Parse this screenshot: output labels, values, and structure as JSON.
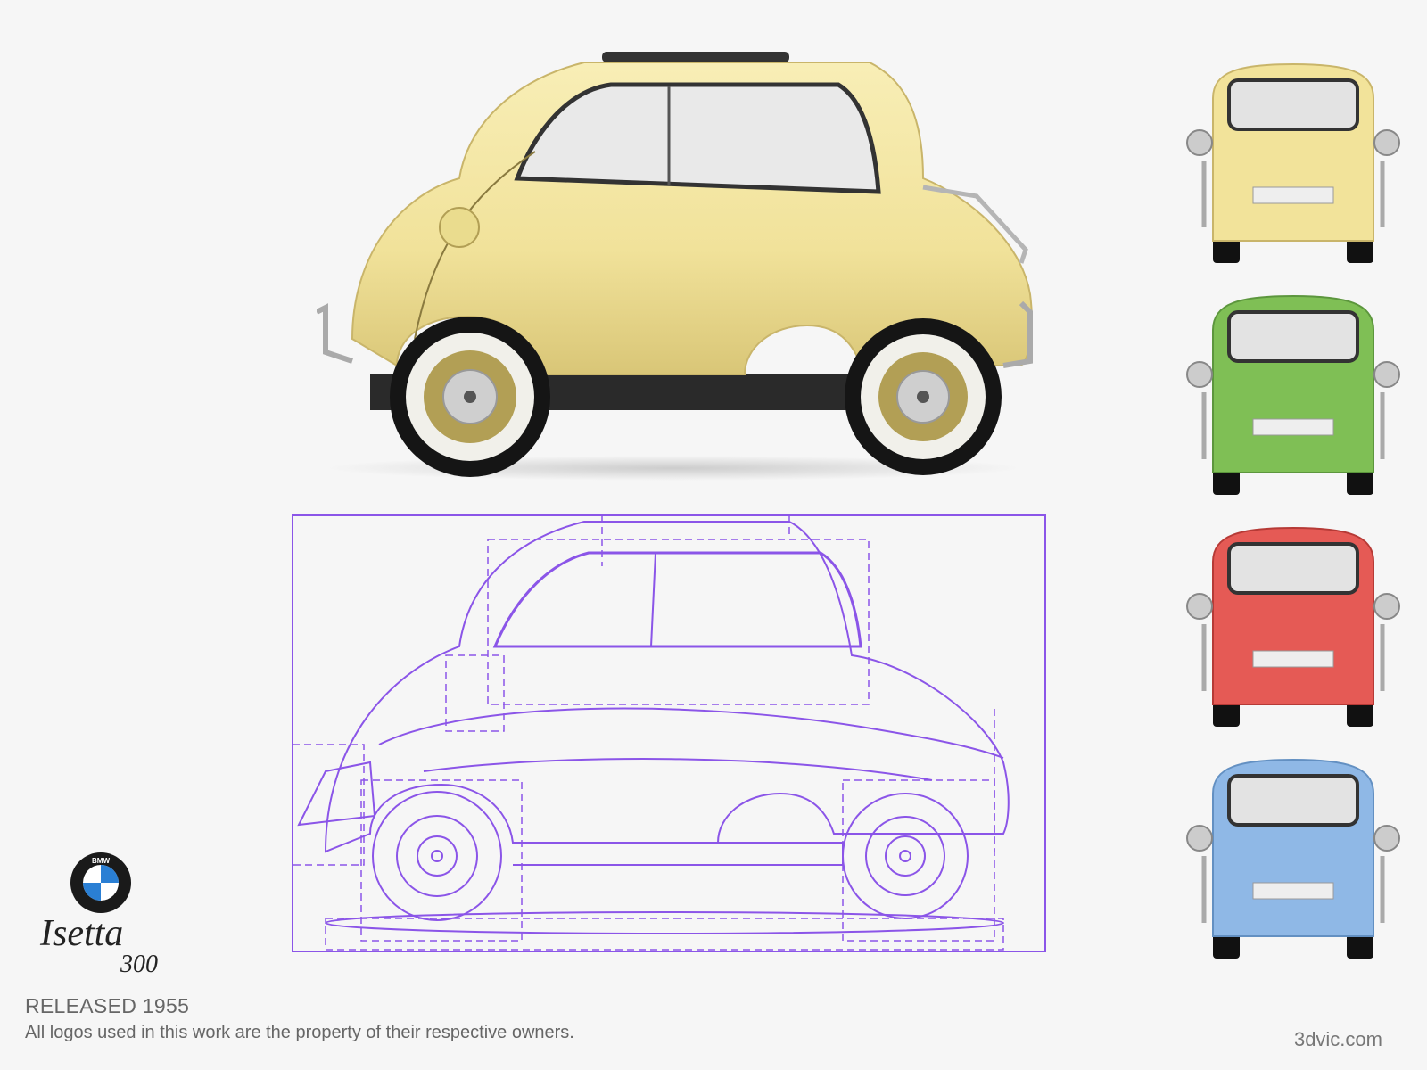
{
  "title": "BMW Isetta 300",
  "brand": {
    "logo_text": "BMW",
    "script_top": "Isetta",
    "script_bottom": "300"
  },
  "info": {
    "released": "RELEASED 1955",
    "disclaimer": "All logos used in this work are the property of their respective owners.",
    "site": "3dvic.com"
  },
  "variants": [
    {
      "name": "yellow",
      "color": "#f2e39a"
    },
    {
      "name": "green",
      "color": "#7fbf55"
    },
    {
      "name": "red",
      "color": "#e55a55"
    },
    {
      "name": "blue",
      "color": "#8fb8e6"
    }
  ],
  "colors": {
    "blueprint": "#8b55e8",
    "side_body": "#f1e39a",
    "text": "#666666"
  }
}
